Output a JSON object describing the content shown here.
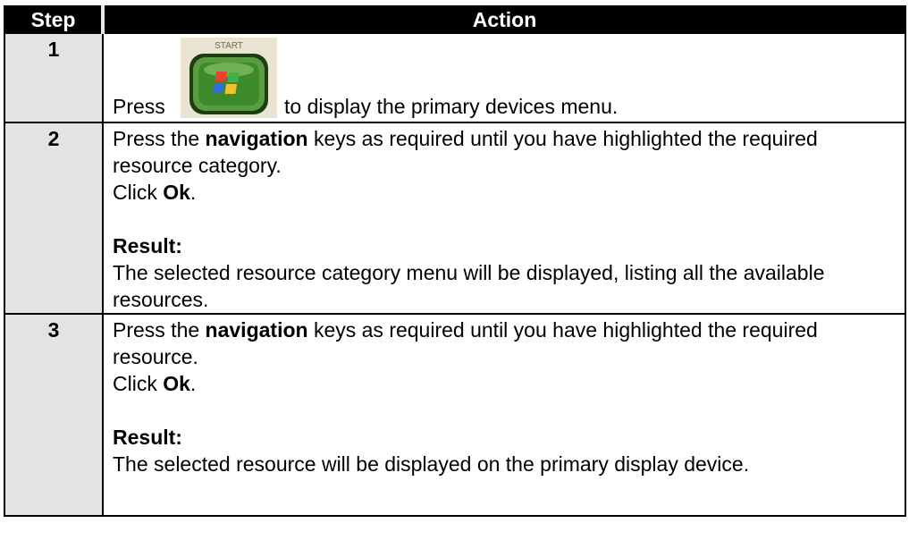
{
  "header": {
    "step": "Step",
    "action": "Action"
  },
  "steps": [
    {
      "number": "1",
      "start_button_label": "START",
      "press": "Press",
      "after_button": "to display the primary devices menu."
    },
    {
      "number": "2",
      "line1_pre": "Press the ",
      "line1_bold": "navigation",
      "line1_post": " keys as required until you have highlighted the required resource category.",
      "click_pre": "Click ",
      "click_bold": "Ok",
      "click_post": ".",
      "result_label": "Result:",
      "result_text": "The selected resource category menu will be displayed, listing all the available resources."
    },
    {
      "number": "3",
      "line1_pre": "Press the ",
      "line1_bold": "navigation",
      "line1_post": " keys as required until you have highlighted the required resource.",
      "click_pre": "Click ",
      "click_bold": "Ok",
      "click_post": ".",
      "result_label": "Result:",
      "result_text": "The selected resource will be displayed on the primary display device."
    }
  ],
  "colors": {
    "header_bg": "#000000",
    "header_text": "#ffffff",
    "step_cell_bg": "#e3e3e3",
    "button_body": "#3d8a2c",
    "button_rim": "#1f3d14"
  }
}
